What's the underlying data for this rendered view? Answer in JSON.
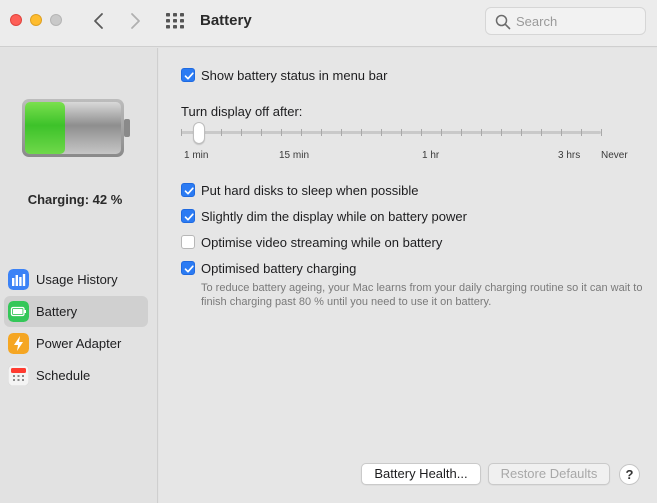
{
  "window": {
    "title": "Battery"
  },
  "search": {
    "placeholder": "Search"
  },
  "sidebar": {
    "charging_status": "Charging: 42 %",
    "battery_level": 0.42,
    "items": [
      {
        "label": "Usage History",
        "icon": "bar-chart-icon",
        "color": "#3b82f6"
      },
      {
        "label": "Battery",
        "icon": "battery-icon",
        "color": "#34c759",
        "selected": true
      },
      {
        "label": "Power Adapter",
        "icon": "lightning-icon",
        "color": "#f5a623"
      },
      {
        "label": "Schedule",
        "icon": "calendar-icon",
        "color": "#ff3b30"
      }
    ]
  },
  "options": {
    "show_status": {
      "label": "Show battery status in menu bar",
      "checked": true
    },
    "display_off_label": "Turn display off after:",
    "slider": {
      "ticks": [
        "1 min",
        "15 min",
        "1 hr",
        "3 hrs",
        "Never"
      ],
      "value": "2 min"
    },
    "disk_sleep": {
      "label": "Put hard disks to sleep when possible",
      "checked": true
    },
    "dim_display": {
      "label": "Slightly dim the display while on battery power",
      "checked": true
    },
    "video_streaming": {
      "label": "Optimise video streaming while on battery",
      "checked": false
    },
    "optimised_charging": {
      "label": "Optimised battery charging",
      "checked": true,
      "description": "To reduce battery ageing, your Mac learns from your daily charging routine so it can wait to finish charging past 80 % until you need to use it on battery."
    }
  },
  "buttons": {
    "battery_health": "Battery Health...",
    "restore_defaults": "Restore Defaults",
    "help": "?"
  },
  "colors": {
    "accent": "#2b7bf3",
    "battery_green": "#4cd964"
  }
}
